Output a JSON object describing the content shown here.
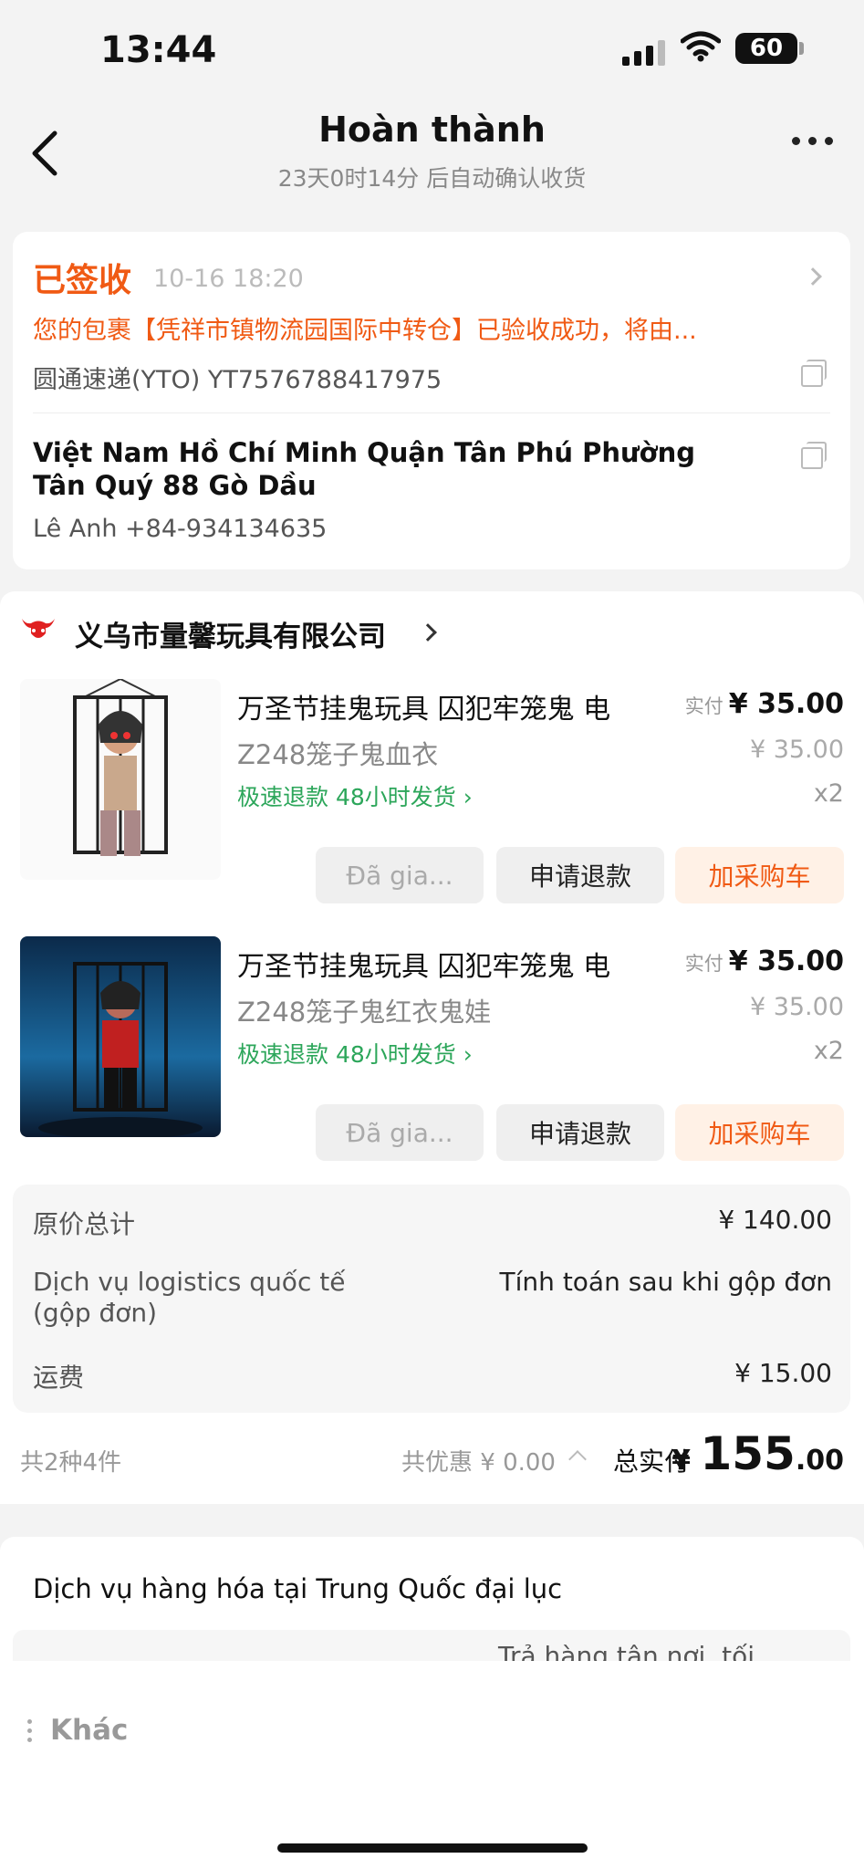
{
  "status_bar": {
    "time": "13:44",
    "battery": "60"
  },
  "header": {
    "title": "Hoàn thành",
    "subtitle": "23天0时14分 后自动确认收货"
  },
  "logistics": {
    "status": "已签收",
    "time": "10-16 18:20",
    "message": "您的包裹【凭祥市镇物流园国际中转仓】已验收成功，将由...",
    "tracking": "圆通速递(YTO) YT7576788417975",
    "address": "Việt Nam Hồ Chí Minh Quận Tân Phú Phường Tân Quý 88 Gò Dầu",
    "contact": "Lê Anh +84-934134635"
  },
  "shop": {
    "name": "义乌市量馨玩具有限公司",
    "items": [
      {
        "title": "万圣节挂鬼玩具 囚犯牢笼鬼 电",
        "sku": "Z248笼子鬼血衣",
        "tags": "极速退款  48小时发货 ›",
        "paid_label": "实付",
        "paid": "¥ 35.00",
        "original": "¥ 35.00",
        "qty": "x2",
        "btn1": "Đã gia...",
        "btn2": "申请退款",
        "btn3": "加采购车"
      },
      {
        "title": "万圣节挂鬼玩具 囚犯牢笼鬼 电",
        "sku": "Z248笼子鬼红衣鬼娃",
        "tags": "极速退款  48小时发货 ›",
        "paid_label": "实付",
        "paid": "¥ 35.00",
        "original": "¥ 35.00",
        "qty": "x2",
        "btn1": "Đã gia...",
        "btn2": "申请退款",
        "btn3": "加采购车"
      }
    ]
  },
  "summary": {
    "original_total_label": "原价总计",
    "original_total": "¥ 140.00",
    "logistics_label": "Dịch vụ logistics quốc tế (gộp đơn)",
    "logistics_value": "Tính toán sau khi gộp đơn",
    "shipping_label": "运费",
    "shipping": "¥ 15.00"
  },
  "totals": {
    "count": "共2种4件",
    "discount": "共优惠 ¥ 0.00",
    "total_label": "总实付",
    "currency": "¥",
    "total_int": "155",
    "total_dec": ".00"
  },
  "service": {
    "title": "Dịch vụ hàng hóa tại Trung Quốc đại lục",
    "cut_text": "Trả hàng tận nơi, tối"
  },
  "bottom": {
    "other": "Khác"
  },
  "colors": {
    "accent": "#f05a14",
    "green": "#2ca65a"
  }
}
